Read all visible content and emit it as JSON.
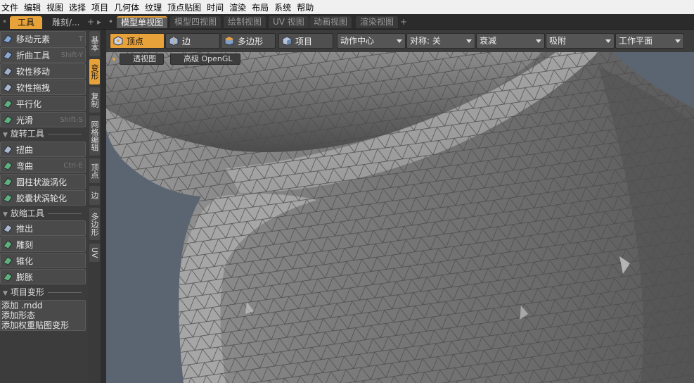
{
  "menu": [
    "文件",
    "编辑",
    "视图",
    "选择",
    "项目",
    "几何体",
    "纹理",
    "顶点贴图",
    "时间",
    "渲染",
    "布局",
    "系统",
    "帮助"
  ],
  "left_tabs": {
    "active": "工具",
    "second": "雕刻/...",
    "plus": "+"
  },
  "view_tabs": [
    "模型单视图",
    "模型四视图",
    "绘制视图",
    "UV 视图",
    "动画视图",
    "渲染视图"
  ],
  "view_tabs_plus": "+",
  "sidebar": {
    "group1": [
      {
        "label": "移动元素",
        "shortcut": "T",
        "icon": "move-element-icon"
      },
      {
        "label": "折曲工具",
        "shortcut": "Shift-Y",
        "icon": "bend-icon"
      },
      {
        "label": "软性移动",
        "shortcut": "",
        "icon": "soft-move-icon"
      },
      {
        "label": "软性拖拽",
        "shortcut": "",
        "icon": "soft-drag-icon"
      },
      {
        "label": "平行化",
        "shortcut": "",
        "icon": "flatten-icon"
      },
      {
        "label": "光滑",
        "shortcut": "Shift-S",
        "icon": "smooth-icon"
      }
    ],
    "group2_title": "旋转工具",
    "group2": [
      {
        "label": "扭曲",
        "shortcut": "",
        "icon": "twist-icon"
      },
      {
        "label": "弯曲",
        "shortcut": "Ctrl-E",
        "icon": "bend2-icon"
      },
      {
        "label": "圆柱状漩涡化",
        "shortcut": "",
        "icon": "swirl-icon"
      },
      {
        "label": "胶囊状涡轮化",
        "shortcut": "",
        "icon": "vortex-icon"
      }
    ],
    "group3_title": "放缩工具",
    "group3": [
      {
        "label": "推出",
        "shortcut": "",
        "icon": "push-icon"
      },
      {
        "label": "雕刻",
        "shortcut": "",
        "icon": "sculpt-icon"
      },
      {
        "label": "锥化",
        "shortcut": "",
        "icon": "taper-icon"
      },
      {
        "label": "膨胀",
        "shortcut": "",
        "icon": "bulge-icon"
      }
    ],
    "group4_title": "项目变形",
    "group4": [
      "添加 .mdd",
      "添加形态",
      "添加权重贴图变形"
    ]
  },
  "vertical_tabs": [
    "基本",
    "变形",
    "复制",
    "网格编辑",
    "顶点",
    "边",
    "多边形",
    "UV"
  ],
  "vertical_active": "变形",
  "toolbar": {
    "modes": [
      {
        "label": "顶点",
        "active": true
      },
      {
        "label": "边",
        "active": false
      },
      {
        "label": "多边形",
        "active": false
      },
      {
        "label": "项目",
        "active": false
      }
    ],
    "dropdowns": [
      "动作中心",
      "对称: 关",
      "衰减",
      "吸附",
      "工作平面"
    ]
  },
  "viewport": {
    "view_label": "透视图",
    "render_label": "高级 OpenGL"
  },
  "colors": {
    "accent": "#e8a23a",
    "mesh": "#8a8a8a",
    "background": "#5b6571"
  }
}
